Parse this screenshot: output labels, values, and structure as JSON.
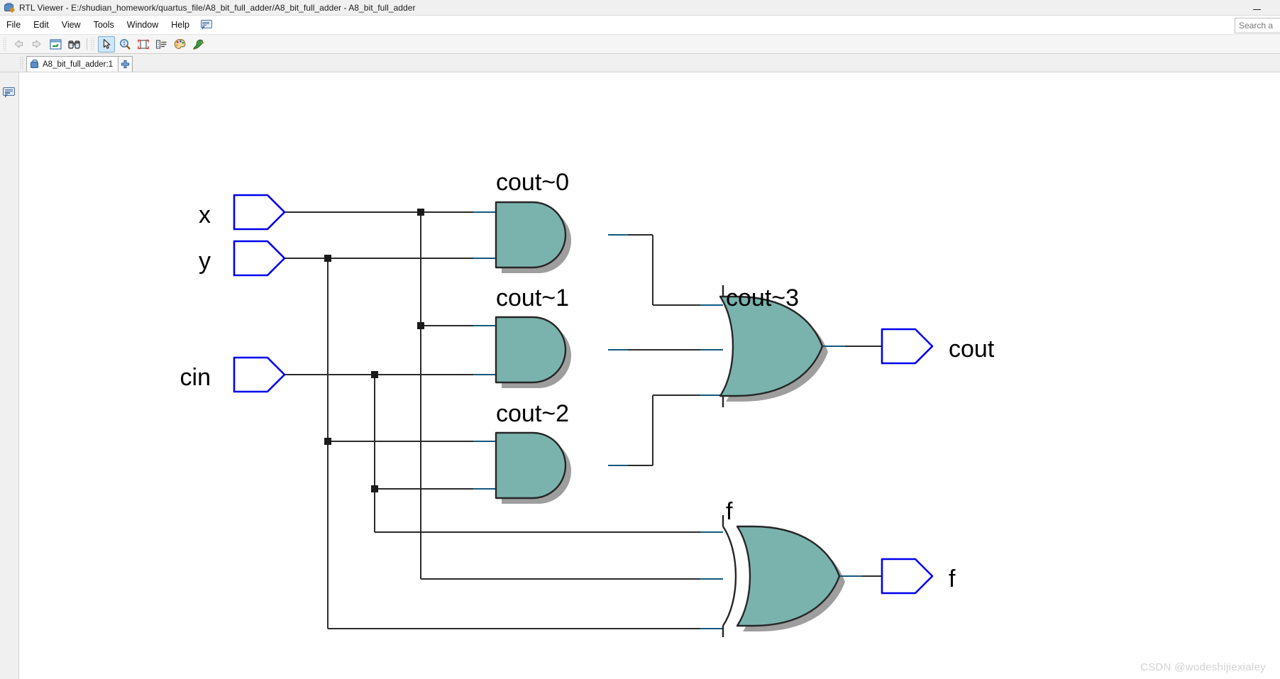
{
  "window": {
    "title": "RTL Viewer - E:/shudian_homework/quartus_file/A8_bit_full_adder/A8_bit_full_adder - A8_bit_full_adder",
    "icon": "rtl-viewer-icon",
    "minimize_label": "—"
  },
  "menubar": {
    "items": [
      {
        "label": "File"
      },
      {
        "label": "Edit"
      },
      {
        "label": "View"
      },
      {
        "label": "Tools"
      },
      {
        "label": "Window"
      },
      {
        "label": "Help"
      }
    ],
    "note_icon": "message-note-icon"
  },
  "search": {
    "placeholder": "Search a",
    "value": ""
  },
  "toolbar": {
    "buttons": [
      {
        "name": "back-button",
        "icon": "arrow-back-icon",
        "state": "disabled"
      },
      {
        "name": "forward-button",
        "icon": "arrow-forward-icon",
        "state": "disabled"
      },
      {
        "name": "refresh-button",
        "icon": "refresh-icon",
        "state": "enabled"
      },
      {
        "name": "find-button",
        "icon": "binoculars-icon",
        "state": "enabled"
      },
      {
        "name": "select-tool-button",
        "icon": "cursor-arrow-icon",
        "state": "active"
      },
      {
        "name": "zoom-tool-button",
        "icon": "magnifier-plusminus-icon",
        "state": "enabled"
      },
      {
        "name": "fit-page-button",
        "icon": "fit-to-page-icon",
        "state": "enabled"
      },
      {
        "name": "hierarchy-button",
        "icon": "hierarchy-list-icon",
        "state": "enabled"
      },
      {
        "name": "color-button",
        "icon": "palette-icon",
        "state": "enabled"
      },
      {
        "name": "probe-button",
        "icon": "parrot-icon",
        "state": "enabled"
      }
    ]
  },
  "tabs": {
    "items": [
      {
        "label": "A8_bit_full_adder:1",
        "icon": "schematic-tab-icon",
        "active": true
      }
    ],
    "add_label": "+"
  },
  "schematic": {
    "title": "A8_bit_full_adder",
    "inputs": [
      {
        "name": "x",
        "label": "x"
      },
      {
        "name": "y",
        "label": "y"
      },
      {
        "name": "cin",
        "label": "cin"
      }
    ],
    "outputs": [
      {
        "name": "cout",
        "label": "cout"
      },
      {
        "name": "f",
        "label": "f"
      }
    ],
    "gates": [
      {
        "name": "cout~0",
        "label": "cout~0",
        "type": "and",
        "inputs": 2
      },
      {
        "name": "cout~1",
        "label": "cout~1",
        "type": "and",
        "inputs": 2
      },
      {
        "name": "cout~2",
        "label": "cout~2",
        "type": "and",
        "inputs": 2
      },
      {
        "name": "cout~3",
        "label": "cout~3",
        "type": "or",
        "inputs": 3
      },
      {
        "name": "f",
        "label": "f",
        "type": "xor",
        "inputs": 3
      }
    ],
    "colors": {
      "gate_fill": "#7ab3ae",
      "gate_stroke": "#262626",
      "gate_shadow": "#9e9e9e",
      "wire": "#2b2b2b",
      "wire_stub": "#13597f",
      "port_stroke": "#0000ee",
      "label_text": "#000000"
    }
  },
  "watermark": {
    "text": "CSDN @wodeshijiexialey"
  }
}
